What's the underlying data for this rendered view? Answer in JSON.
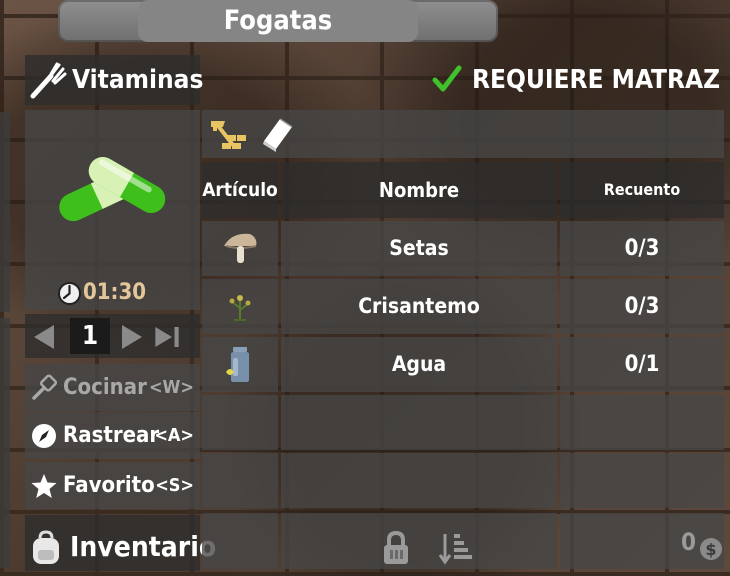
{
  "window": {
    "title": "Fogatas"
  },
  "recipe": {
    "name": "Vitaminas",
    "requirement": "REQUIERE MATRAZ",
    "time": "01:30",
    "quantity": "1"
  },
  "actions": [
    {
      "label": "Cocinar",
      "key": "<W>",
      "enabled": false
    },
    {
      "label": "Rastrear",
      "key": "<A>",
      "enabled": true
    },
    {
      "label": "Favorito",
      "key": "<S>",
      "enabled": true
    }
  ],
  "inventory": {
    "label": "Inventario",
    "money": "0"
  },
  "table": {
    "headers": {
      "item": "Artículo",
      "name": "Nombre",
      "count": "Recuento"
    },
    "rows": [
      {
        "icon": "mushroom-icon",
        "name": "Setas",
        "count": "0/3"
      },
      {
        "icon": "chrysanthemum-icon",
        "name": "Crisantemo",
        "count": "0/3"
      },
      {
        "icon": "water-jar-icon",
        "name": "Agua",
        "count": "0/1"
      }
    ]
  },
  "icons": {
    "header": "fork-icon",
    "requirement": "checkmark-icon",
    "product": "vitamin-pills-icon",
    "timer": "clock-icon",
    "workstation": "workbench-icon",
    "book": "book-icon",
    "footer": [
      "lock-icon",
      "sort-icon",
      "coin-icon"
    ]
  },
  "colors": {
    "check": "#3fc22b",
    "pill_green": "#3fbf1c",
    "pill_light": "#d7f2b4",
    "timer_text": "#e3c79b"
  }
}
